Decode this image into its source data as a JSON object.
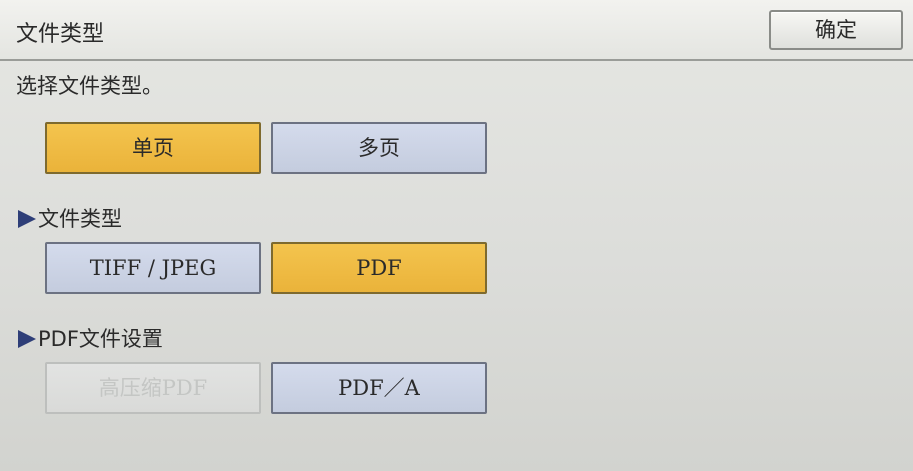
{
  "header": {
    "title": "文件类型",
    "ok_label": "确定"
  },
  "instruction": "选择文件类型。",
  "page_mode": {
    "options": [
      {
        "label": "单页",
        "selected": true
      },
      {
        "label": "多页",
        "selected": false
      }
    ]
  },
  "file_type": {
    "heading": "文件类型",
    "options": [
      {
        "label": "TIFF / JPEG",
        "selected": false
      },
      {
        "label": "PDF",
        "selected": true
      }
    ]
  },
  "pdf_settings": {
    "heading": "PDF文件设置",
    "options": [
      {
        "label": "高压缩PDF",
        "enabled": false
      },
      {
        "label": "PDF／A",
        "enabled": true
      }
    ]
  },
  "colors": {
    "selected": "#f0bc46",
    "normal": "#ccd3e5",
    "disabled": "#dedfdd",
    "heading_arrow": "#2e3e78"
  }
}
